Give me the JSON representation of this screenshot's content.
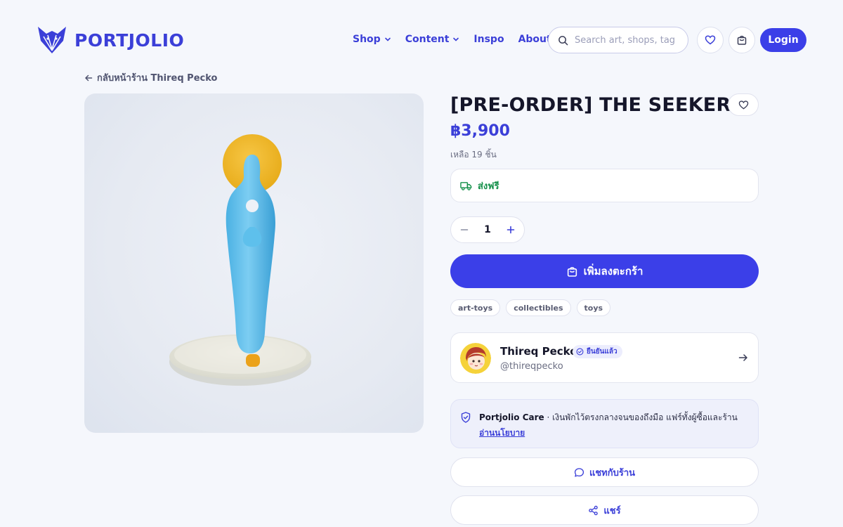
{
  "brand": {
    "name": "PORTJOLIO",
    "accent": "#3b3fe8"
  },
  "nav": {
    "items": [
      {
        "label": "Shop",
        "has_dropdown": true
      },
      {
        "label": "Content",
        "has_dropdown": true
      },
      {
        "label": "Inspo",
        "has_dropdown": false
      },
      {
        "label": "About",
        "has_dropdown": false
      }
    ]
  },
  "search": {
    "placeholder": "Search art, shops, tag",
    "value": ""
  },
  "header_actions": {
    "wishlist_icon": "heart-icon",
    "cart_icon": "shopping-bag-icon",
    "login_label": "Login"
  },
  "breadcrumb": {
    "back_label": "กลับหน้าร้าน Thireq Pecko"
  },
  "product": {
    "title": "[PRE-ORDER] THE SEEKER",
    "price": "฿3,900",
    "stock": "เหลือ 19 ชิ้น",
    "shipping": "ส่งฟรี",
    "quantity": "1",
    "add_to_cart": "เพิ่มลงตะกร้า",
    "tags": [
      "art-toys",
      "collectibles",
      "toys"
    ]
  },
  "shop": {
    "name": "Thireq Pecko",
    "handle": "@thireqpecko",
    "verified_label": "ยืนยันแล้ว"
  },
  "care": {
    "title": "Portjolio Care",
    "description": " · เงินพักไว้ตรงกลางจนของถึงมือ แฟร์ทั้งผู้ซื้อและร้าน",
    "link": "อ่านนโยบาย"
  },
  "actions": {
    "chat": "แชทกับร้าน",
    "share": "แชร์"
  }
}
